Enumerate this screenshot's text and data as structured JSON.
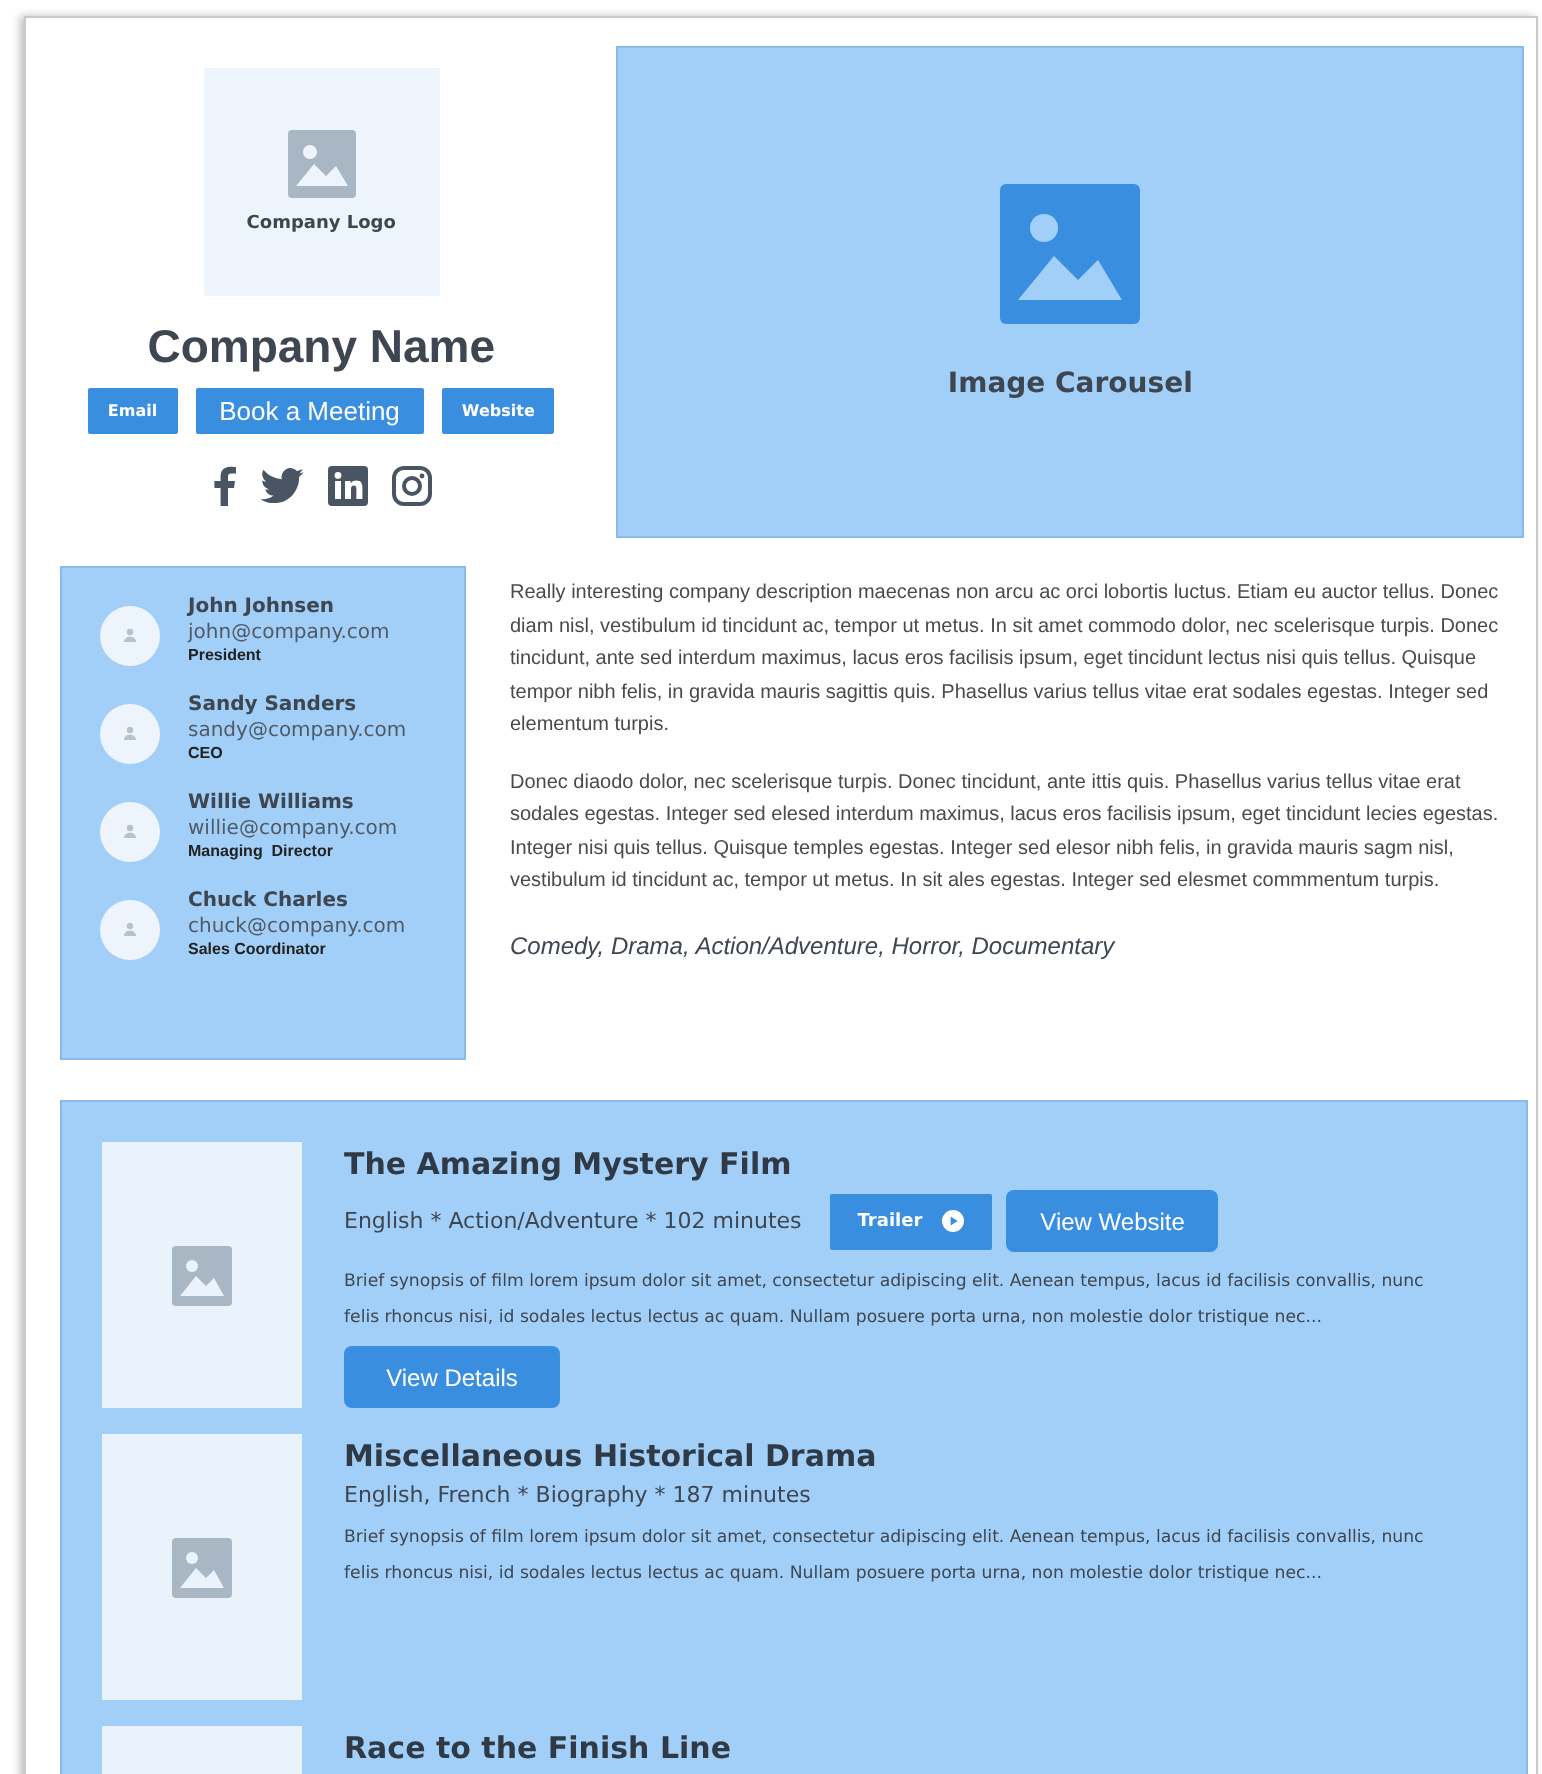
{
  "company": {
    "logo_label": "Company Logo",
    "name": "Company Name",
    "buttons": [
      {
        "label": "Email",
        "kind": "small"
      },
      {
        "label": "Book a Meeting",
        "kind": "large"
      },
      {
        "label": "Website",
        "kind": "small"
      }
    ]
  },
  "carousel": {
    "label": "Image Carousel"
  },
  "team": [
    {
      "name": "John Johnsen",
      "email": "john@company.com",
      "role": "President"
    },
    {
      "name": "Sandy Sanders",
      "email": "sandy@company.com",
      "role": "CEO"
    },
    {
      "name": "Willie Williams",
      "email": "willie@company.com",
      "role": "Managing  Director"
    },
    {
      "name": "Chuck Charles",
      "email": "chuck@company.com",
      "role": "Sales Coordinator"
    }
  ],
  "description": {
    "paragraphs": [
      "Really interesting company description maecenas non arcu ac orci lobortis luctus. Etiam eu auctor tellus. Donec diam nisl, vestibulum id tincidunt ac, tempor ut metus. In sit amet commodo dolor, nec scelerisque turpis. Donec tincidunt, ante sed interdum maximus, lacus eros facilisis ipsum, eget tincidunt lectus nisi quis tellus. Quisque tempor nibh felis, in gravida mauris sagittis quis. Phasellus varius tellus vitae erat sodales egestas. Integer sed elementum turpis.",
      "Donec diaodo dolor, nec scelerisque turpis. Donec tincidunt, ante ittis quis. Phasellus varius tellus vitae erat sodales egestas. Integer sed elesed interdum maximus, lacus eros facilisis ipsum, eget tincidunt lecies egestas. Integer nisi quis tellus. Quisque temples egestas. Integer sed elesor nibh felis, in gravida mauris sagm nisl, vestibulum id tincidunt ac, tempor ut metus. In sit ales egestas. Integer sed elesmet commmentum turpis."
    ],
    "genres": "Comedy, Drama, Action/Adventure, Horror, Documentary"
  },
  "films": [
    {
      "title": "The Amazing Mystery Film",
      "meta": "English * Action/Adventure * 102 minutes",
      "synopsis": "Brief synopsis of film lorem ipsum dolor sit amet, consectetur adipiscing elit. Aenean tempus, lacus id facilisis convallis, nunc felis rhoncus nisi, id sodales lectus lectus ac quam. Nullam posuere porta urna, non molestie dolor tristique nec...",
      "trailer_button": "Trailer",
      "website_button": "View Website",
      "details_button": "View Details"
    },
    {
      "title": "Miscellaneous Historical Drama",
      "meta": "English, French * Biography * 187 minutes",
      "synopsis": "Brief synopsis of film lorem ipsum dolor sit amet, consectetur adipiscing elit. Aenean tempus, lacus id facilisis convallis, nunc felis rhoncus nisi, id sodales lectus lectus ac quam. Nullam posuere porta urna, non molestie dolor tristique nec..."
    },
    {
      "title": "Race to the Finish Line"
    }
  ]
}
